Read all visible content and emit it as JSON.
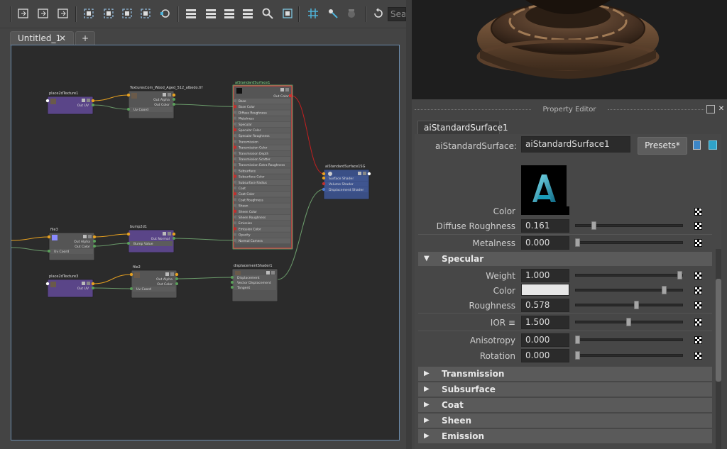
{
  "toolbar": {
    "icons": [
      "node-select-icon",
      "graph-in-icon",
      "graph-out-icon",
      "frame-all-icon",
      "frame-selected-icon",
      "layout-icon",
      "connect-icon",
      "pin-icon",
      "layout-simple-icon",
      "layout-connected-icon",
      "layout-full-icon",
      "layout-custom-icon",
      "search-icon",
      "camera-icon",
      "grid-icon",
      "snap-icon",
      "settings-icon",
      "shader-icon",
      "refresh-icon"
    ],
    "search_placeholder": "Sea"
  },
  "tabs": {
    "active": "Untitled_1",
    "close": "✕",
    "add": "+"
  },
  "nodes": [
    {
      "id": "p2d1",
      "title": "place2dTexture1",
      "color": "#5a4588",
      "ports_out": [
        "Out UV"
      ]
    },
    {
      "id": "tex",
      "title": "TexturesCom_Wood_Aged_512_albedo.tif",
      "color": "#555",
      "ports_out": [
        "Out Alpha",
        "Out Color"
      ],
      "ports_in": [
        "Uv Coord"
      ]
    },
    {
      "id": "ai",
      "title": "aiStandardSurface1",
      "color": "#555",
      "port_top": "Out Color",
      "ports_in": [
        "Base",
        "Base Color",
        "Diffuse Roughness",
        "Metalness",
        "Specular",
        "Specular Color",
        "Specular Roughness",
        "Transmission",
        "Transmission Color",
        "Transmission Depth",
        "Transmission Scatter",
        "Transmission Extra Roughness",
        "Subsurface",
        "Subsurface Color",
        "Subsurface Radius",
        "Coat",
        "Coat Color",
        "Coat Roughness",
        "Sheen",
        "Sheen Color",
        "Sheen Roughness",
        "Emission",
        "Emission Color",
        "Opacity",
        "Normal Camera"
      ]
    },
    {
      "id": "sg",
      "title": "aiStandardSurface1SG",
      "color": "#3a4f86",
      "ports_in": [
        "Surface Shader",
        "Volume Shader",
        "Displacement Shader"
      ]
    },
    {
      "id": "file3",
      "title": "file3",
      "color": "#555",
      "ports_out": [
        "Out Alpha",
        "Out Color"
      ],
      "ports_in": [
        "Uv Coord"
      ]
    },
    {
      "id": "bump",
      "title": "bump2d1",
      "color": "#5a4588",
      "ports_out": [
        "Out Normal"
      ],
      "ports_in": [
        "Bump Value"
      ]
    },
    {
      "id": "p2d3",
      "title": "place2dTexture3",
      "color": "#5a4588",
      "ports_out": [
        "Out UV"
      ]
    },
    {
      "id": "file2",
      "title": "file2",
      "color": "#555",
      "ports_out": [
        "Out Alpha",
        "Out Color"
      ],
      "ports_in": [
        "Uv Coord"
      ]
    },
    {
      "id": "disp",
      "title": "displacementShader1",
      "color": "#555",
      "ports_in": [
        "Displacement",
        "Vector Displacement",
        "Tangent"
      ]
    }
  ],
  "property_editor": {
    "title": "Property Editor",
    "tab": "aiStandardSurface1",
    "node_label": "aiStandardSurface:",
    "node_name": "aiStandardSurface1",
    "presets": "Presets*",
    "partial_label": "Color",
    "base_rows": [
      {
        "label": "Diffuse Roughness",
        "value": "0.161",
        "slider": 0.161
      },
      {
        "label": "Metalness",
        "value": "0.000",
        "slider": 0.0
      }
    ],
    "specular": {
      "title": "Specular",
      "rows": [
        {
          "label": "Weight",
          "value": "1.000",
          "slider": 1.0
        },
        {
          "label": "Color",
          "value": "",
          "slider": 0.85,
          "swatch": "#e6e6e6"
        },
        {
          "label": "Roughness",
          "value": "0.578",
          "slider": 0.578
        },
        {
          "label": "IOR ≡",
          "value": "1.500",
          "slider": 0.5
        },
        {
          "label": "Anisotropy",
          "value": "0.000",
          "slider": 0.0
        },
        {
          "label": "Rotation",
          "value": "0.000",
          "slider": 0.0
        }
      ]
    },
    "collapsed_sections": [
      "Transmission",
      "Subsurface",
      "Coat",
      "Sheen",
      "Emission"
    ],
    "expand_arrow": "▼",
    "collapse_arrow": "▶"
  }
}
